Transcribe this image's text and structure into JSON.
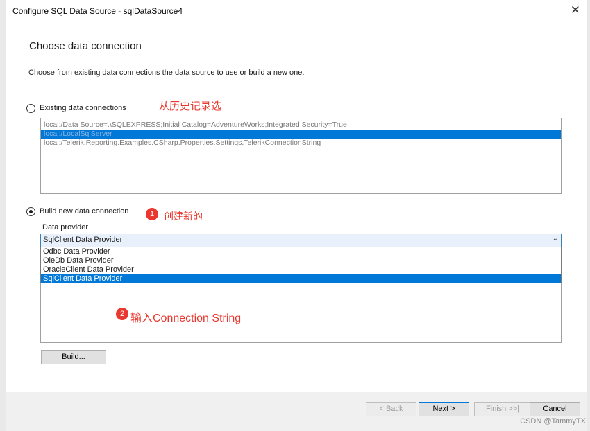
{
  "window": {
    "title": "Configure SQL Data Source - sqlDataSource4",
    "close_glyph": "✕"
  },
  "heading": "Choose data connection",
  "description": "Choose from existing data connections the data source to use or build a new one.",
  "existing": {
    "label": "Existing data connections",
    "annotation": "从历史记录选",
    "items": [
      "local:/Data Source=.\\SQLEXPRESS;Initial Catalog=AdventureWorks;Integrated Security=True",
      "local:/LocalSqlServer",
      "local:/Telerik.Reporting.Examples.CSharp.Properties.Settings.TelerikConnectionString"
    ]
  },
  "build_new": {
    "label": "Build new data connection",
    "badge": "1",
    "annotation": "创建新的",
    "provider_label": "Data provider",
    "selected_provider": "SqlClient Data Provider",
    "options": [
      "Odbc Data Provider",
      "OleDb Data Provider",
      "OracleClient Data Provider",
      "SqlClient Data Provider"
    ],
    "connection_badge": "2",
    "connection_annotation": "输入Connection String",
    "build_button": "Build..."
  },
  "footer": {
    "back": "< Back",
    "next": "Next >",
    "finish": "Finish >>|",
    "cancel": "Cancel"
  },
  "watermark": "CSDN @TammyTX",
  "colors": {
    "accent": "#0078d7",
    "annotation": "#e8382f"
  }
}
